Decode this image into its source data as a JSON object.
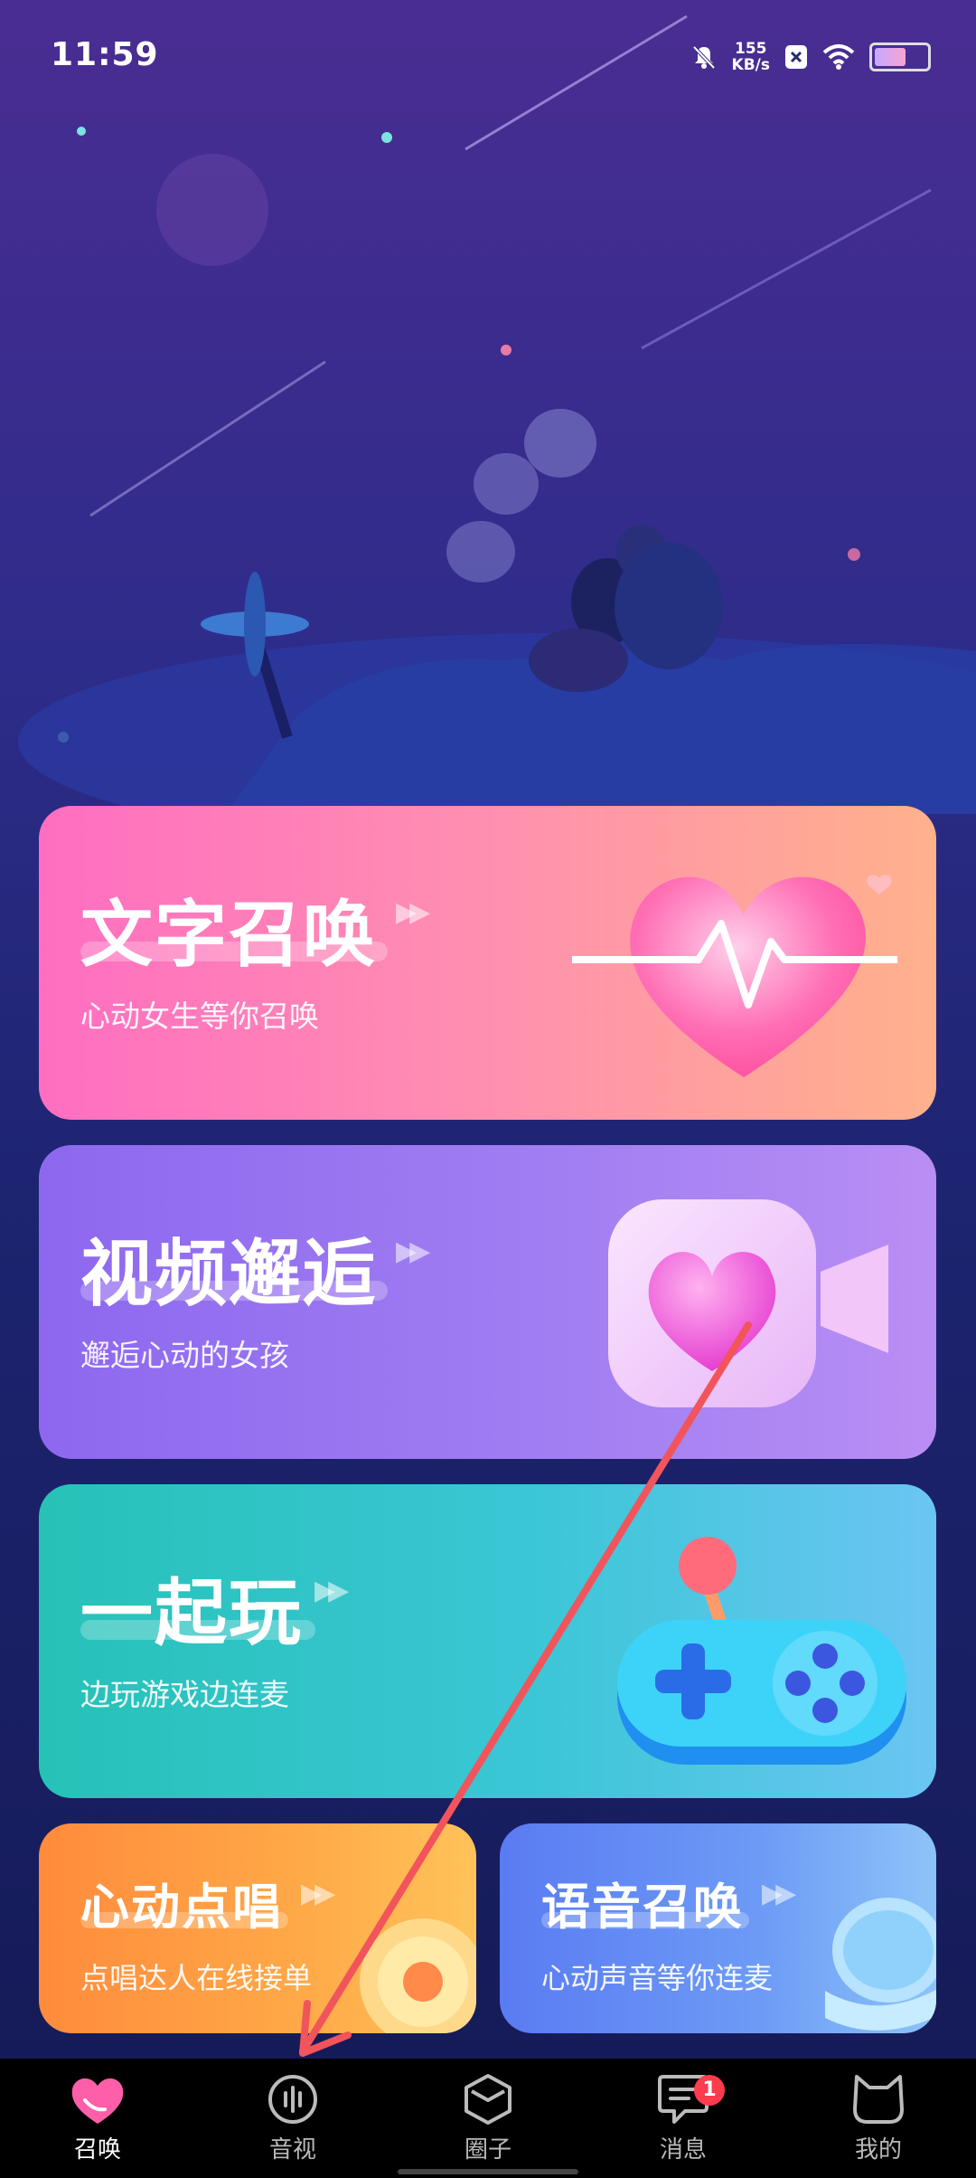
{
  "status_bar": {
    "time": "11:59",
    "net_speed_value": "155",
    "net_speed_unit": "KB/s",
    "icons": [
      "mute-bell-icon",
      "close-box-icon",
      "wifi-icon",
      "battery-icon"
    ]
  },
  "cards": {
    "text_summon": {
      "title": "文字召唤",
      "subtitle": "心动女生等你召唤",
      "icon": "heart-pulse-icon"
    },
    "video_meet": {
      "title": "视频邂逅",
      "subtitle": "邂逅心动的女孩",
      "icon": "video-heart-icon"
    },
    "play_together": {
      "title": "一起玩",
      "subtitle": "边玩游戏边连麦",
      "icon": "gamepad-icon"
    },
    "heart_sing": {
      "title": "心动点唱",
      "subtitle": "点唱达人在线接单",
      "icon": "disc-icon"
    },
    "voice_summon": {
      "title": "语音召唤",
      "subtitle": "心动声音等你连麦",
      "icon": "microphone-icon"
    }
  },
  "nav": {
    "items": [
      {
        "label": "召唤",
        "icon": "heart-icon",
        "active": true
      },
      {
        "label": "音视",
        "icon": "audio-wave-icon",
        "active": false
      },
      {
        "label": "圈子",
        "icon": "hexagon-icon",
        "active": false
      },
      {
        "label": "消息",
        "icon": "chat-bubble-icon",
        "active": false,
        "badge": "1"
      },
      {
        "label": "我的",
        "icon": "cat-face-icon",
        "active": false
      }
    ]
  },
  "colors": {
    "text_summon": "#ff7fb8",
    "video_meet": "#9a78f0",
    "play_together": "#35c3c8",
    "heart_sing": "#ffa044",
    "voice_summon": "#6a92f4",
    "badge": "#ff3b4e",
    "annotation_arrow": "#f2545b"
  }
}
